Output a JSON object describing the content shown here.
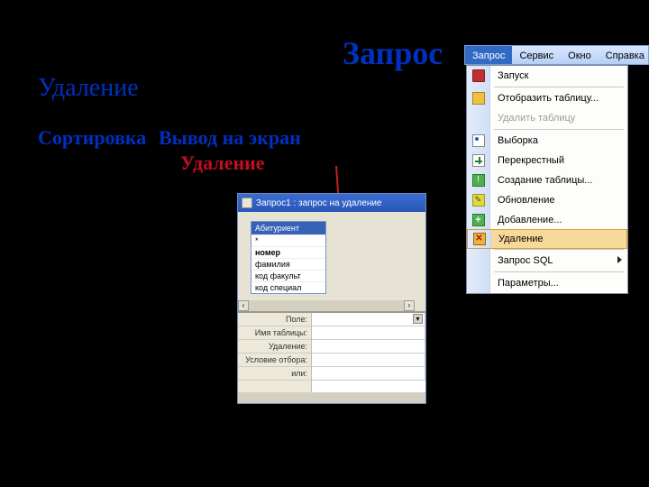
{
  "slide": {
    "title_big": "Запрос",
    "udalenie": "Удаление",
    "sortirovka": "Сортировка",
    "vyvod": "Вывод на экран",
    "udalenie_red": "Удаление"
  },
  "qd": {
    "title": "Запрос1 : запрос на удаление",
    "table_name": "Абитуриент",
    "fields": [
      "*",
      "номер",
      "фамилия",
      "код факульт",
      "код специал"
    ],
    "grid_labels": [
      "Поле:",
      "Имя таблицы:",
      "Удаление:",
      "Условие отбора:",
      "или:"
    ]
  },
  "menubar": {
    "items": [
      "Запрос",
      "Сервис",
      "Окно",
      "Справка"
    ]
  },
  "dropdown": {
    "run": "Запуск",
    "show_table": "Отобразить таблицу...",
    "del_table": "Удалить таблицу",
    "select": "Выборка",
    "crosstab": "Перекрестный",
    "create_table": "Создание таблицы...",
    "update": "Обновление",
    "append": "Добавление...",
    "delete": "Удаление",
    "sql": "Запрос SQL",
    "params": "Параметры..."
  }
}
